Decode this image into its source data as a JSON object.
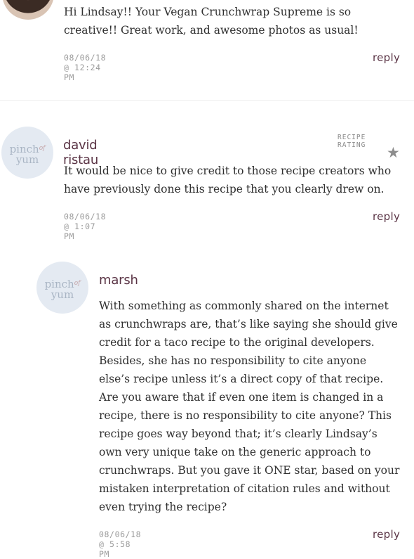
{
  "comments": [
    {
      "text": "Hi Lindsay!! Your Vegan Crunchwrap Supreme is so creative!! Great work, and awesome photos as usual!",
      "timestamp": "08/06/18 @ 12:24 PM",
      "reply_label": "reply"
    },
    {
      "author": "david ristau",
      "avatar_logo": {
        "line1": "pinch",
        "of": "of",
        "line2": "yum"
      },
      "rating_label": "RECIPE RATING",
      "rating_stars": 1,
      "star_glyph": "★",
      "text": "It would be nice to give credit to those recipe creators who have previously done this recipe that you clearly drew on.",
      "timestamp": "08/06/18 @ 1:07 PM",
      "reply_label": "reply"
    },
    {
      "author": "marsh",
      "avatar_logo": {
        "line1": "pinch",
        "of": "of",
        "line2": "yum"
      },
      "text": "With something as commonly shared on the internet as crunchwraps are, that’s like saying she should give credit for a taco recipe to the original developers. Besides, she has no responsibility to cite anyone else’s recipe unless it’s a direct copy of that recipe. Are you aware that if even one item is changed in a recipe, there is no responsibility to cite anyone? This recipe goes way beyond that; it’s clearly Lindsay’s own very unique take on the generic approach to crunchwraps. But you gave it ONE star, based on your mistaken interpretation of citation rules and without even trying the recipe?",
      "timestamp": "08/06/18 @ 5:58 PM",
      "reply_label": "reply"
    }
  ],
  "colors": {
    "author": "#5a3445",
    "meta": "#9b9b9b",
    "avatar_bg": "#e4eaf2"
  }
}
